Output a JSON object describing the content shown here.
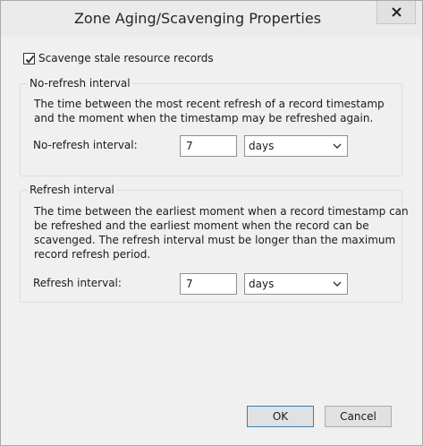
{
  "dialog": {
    "title": "Zone Aging/Scavenging Properties",
    "close_glyph": "x"
  },
  "scavenge_checkbox": {
    "label": "Scavenge stale resource records",
    "checked": true
  },
  "no_refresh": {
    "group_title": "No-refresh interval",
    "description": [
      "The time between the most recent refresh of a record timestamp",
      "and the moment when the timestamp may be refreshed again."
    ],
    "field_label": "No-refresh interval:",
    "value": "7",
    "unit": "days"
  },
  "refresh": {
    "group_title": "Refresh interval",
    "description": [
      "The time between the earliest moment when a record timestamp can",
      "be refreshed and the earliest moment when the record can be",
      "scavenged. The refresh interval must be longer than the maximum",
      "record refresh period."
    ],
    "field_label": "Refresh interval:",
    "value": "7",
    "unit": "days"
  },
  "buttons": {
    "ok": "OK",
    "cancel": "Cancel"
  }
}
